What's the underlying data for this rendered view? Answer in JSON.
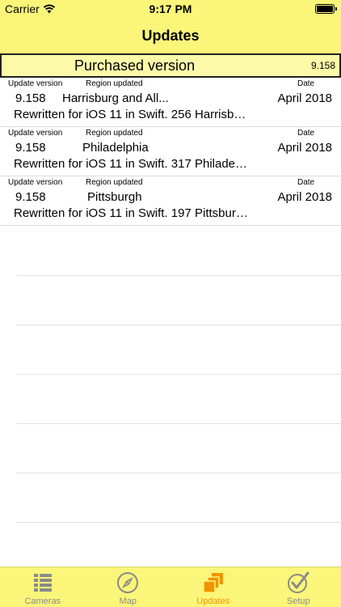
{
  "status": {
    "carrier": "Carrier",
    "time": "9:17 PM"
  },
  "nav": {
    "title": "Updates"
  },
  "purchased": {
    "label": "Purchased version",
    "version": "9.158"
  },
  "headers": {
    "update_version": "Update version",
    "region_updated": "Region updated",
    "date": "Date"
  },
  "rows": [
    {
      "version": "9.158",
      "region": "Harrisburg and All...",
      "date": "April 2018",
      "description": "Rewritten for iOS 11 in Swift. 256 Harrisbur..."
    },
    {
      "version": "9.158",
      "region": "Philadelphia",
      "date": "April 2018",
      "description": "Rewritten for iOS 11 in Swift. 317 Philadelp..."
    },
    {
      "version": "9.158",
      "region": "Pittsburgh",
      "date": "April 2018",
      "description": "Rewritten for iOS 11 in Swift. 197 Pittsburg..."
    }
  ],
  "tabs": [
    {
      "label": "Cameras",
      "icon": "list-icon"
    },
    {
      "label": "Map",
      "icon": "compass-icon"
    },
    {
      "label": "Updates",
      "icon": "stacked-squares-icon"
    },
    {
      "label": "Setup",
      "icon": "checkmark-circle-icon"
    }
  ],
  "colors": {
    "bar": "#fbf67a",
    "active_tab": "#f29400",
    "inactive_tab": "#8a8a8a"
  }
}
